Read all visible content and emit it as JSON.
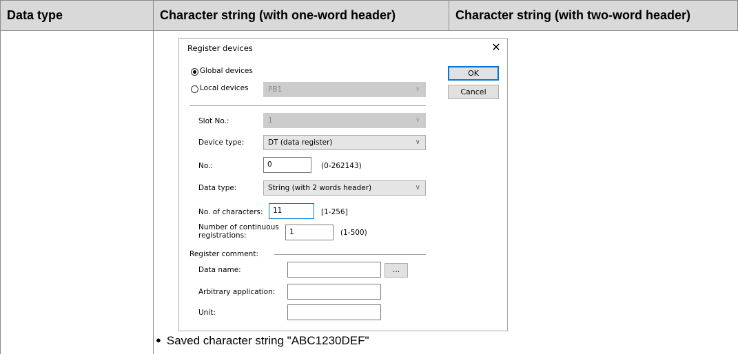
{
  "table": {
    "headers": [
      "Data type",
      "Character string (with one-word header)",
      "Character string (with two-word header)"
    ],
    "caption": "Saved character string \"ABC1230DEF\"",
    "bullet": "●"
  },
  "dialog": {
    "title": "Register devices",
    "close_icon": "✕",
    "ok_label": "OK",
    "cancel_label": "Cancel",
    "global_devices_label": "Global devices",
    "global_devices_selected": true,
    "local_devices_label": "Local devices",
    "local_devices_selected": false,
    "local_devices_value": "PB1",
    "slot_no": {
      "label": "Slot No.:",
      "value": "1"
    },
    "device_type": {
      "label": "Device type:",
      "value": "DT (data register)"
    },
    "no": {
      "label": "No.:",
      "value": "0",
      "range": "(0-262143)"
    },
    "data_type": {
      "label": "Data type:",
      "value": "String (with 2 words header)"
    },
    "num_characters": {
      "label": "No. of characters:",
      "value": "11",
      "range": "[1-256]"
    },
    "continuous": {
      "label_line1": "Number of continuous",
      "label_line2": "registrations:",
      "value": "1",
      "range": "(1-500)"
    },
    "register_comment_label": "Register comment:",
    "data_name": {
      "label": "Data name:",
      "value": "",
      "browse_label": "..."
    },
    "arbitrary_application": {
      "label": "Arbitrary application:",
      "value": ""
    },
    "unit": {
      "label": "Unit:",
      "value": ""
    },
    "dropdown_icon": "chevron-down-icon"
  }
}
